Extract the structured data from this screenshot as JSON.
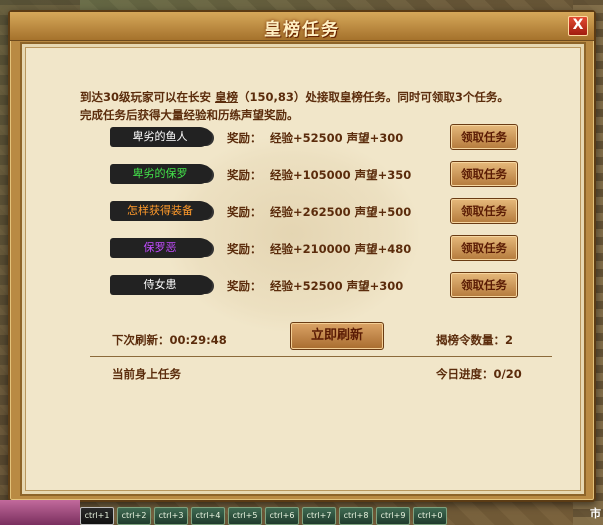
{
  "window": {
    "title": "皇榜任务",
    "close_label": "X"
  },
  "intro": {
    "text_before": "到达30级玩家可以在长安 ",
    "place": "皇榜",
    "text_after": "（150,83）处接取皇榜任务。同时可领取3个任务。完成任务后获得大量经验和历练声望奖励。"
  },
  "tasks": [
    {
      "name": "卑劣的鱼人",
      "name_color": "#ffffff",
      "reward_label": "奖励：",
      "reward": "经验+52500 声望+300",
      "button": "领取任务"
    },
    {
      "name": "卑劣的保罗",
      "name_color": "#43e34a",
      "reward_label": "奖励：",
      "reward": "经验+105000 声望+350",
      "button": "领取任务"
    },
    {
      "name": "怎样获得装备",
      "name_color": "#ff9a2b",
      "reward_label": "奖励：",
      "reward": "经验+262500 声望+500",
      "button": "领取任务"
    },
    {
      "name": "保罗恶",
      "name_color": "#c24bff",
      "reward_label": "奖励：",
      "reward": "经验+210000 声望+480",
      "button": "领取任务"
    },
    {
      "name": "侍女患",
      "name_color": "#ffffff",
      "reward_label": "奖励：",
      "reward": "经验+52500 声望+300",
      "button": "领取任务"
    }
  ],
  "footer": {
    "next_refresh": "下次刷新：00:29:48",
    "refresh_button": "立即刷新",
    "token_count": "揭榜令数量：2",
    "current_tasks_label": "当前身上任务",
    "today_progress": "今日进度：0/20"
  },
  "hotkeys": [
    "ctrl+1",
    "ctrl+2",
    "ctrl+3",
    "ctrl+4",
    "ctrl+5",
    "ctrl+6",
    "ctrl+7",
    "ctrl+8",
    "ctrl+9",
    "ctrl+0"
  ],
  "map_tag": "市"
}
